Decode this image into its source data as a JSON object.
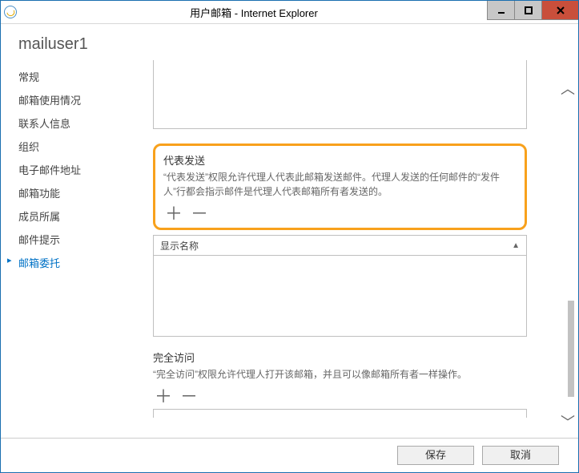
{
  "window": {
    "title": "用户邮箱 - Internet Explorer"
  },
  "page": {
    "heading": "mailuser1"
  },
  "sidebar": {
    "items": [
      {
        "label": "常规",
        "active": false
      },
      {
        "label": "邮箱使用情况",
        "active": false
      },
      {
        "label": "联系人信息",
        "active": false
      },
      {
        "label": "组织",
        "active": false
      },
      {
        "label": "电子邮件地址",
        "active": false
      },
      {
        "label": "邮箱功能",
        "active": false
      },
      {
        "label": "成员所属",
        "active": false
      },
      {
        "label": "邮件提示",
        "active": false
      },
      {
        "label": "邮箱委托",
        "active": true
      }
    ]
  },
  "section_send_on_behalf": {
    "title": "代表发送",
    "desc": "“代表发送”权限允许代理人代表此邮箱发送邮件。代理人发送的任何邮件的“发件人”行都会指示邮件是代理人代表邮箱所有者发送的。",
    "list_header": "显示名称"
  },
  "section_full_access": {
    "title": "完全访问",
    "desc": "“完全访问”权限允许代理人打开该邮箱，并且可以像邮箱所有者一样操作。"
  },
  "footer": {
    "save": "保存",
    "cancel": "取消"
  },
  "glyphs": {
    "plus": "＋",
    "minus": "－"
  }
}
